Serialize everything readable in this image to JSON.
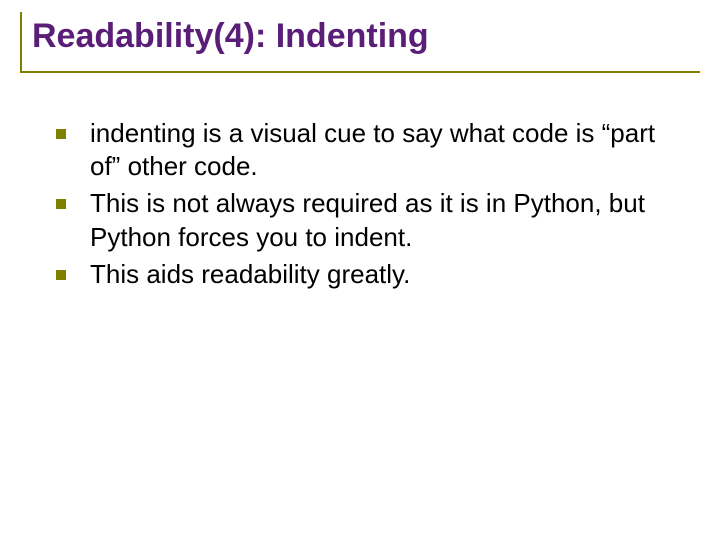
{
  "title": "Readability(4): Indenting",
  "bullets": [
    "indenting is a visual cue to say what code is “part of” other code.",
    "This is not always required as it is in Python, but Python forces you to indent.",
    "This aids readability greatly."
  ]
}
